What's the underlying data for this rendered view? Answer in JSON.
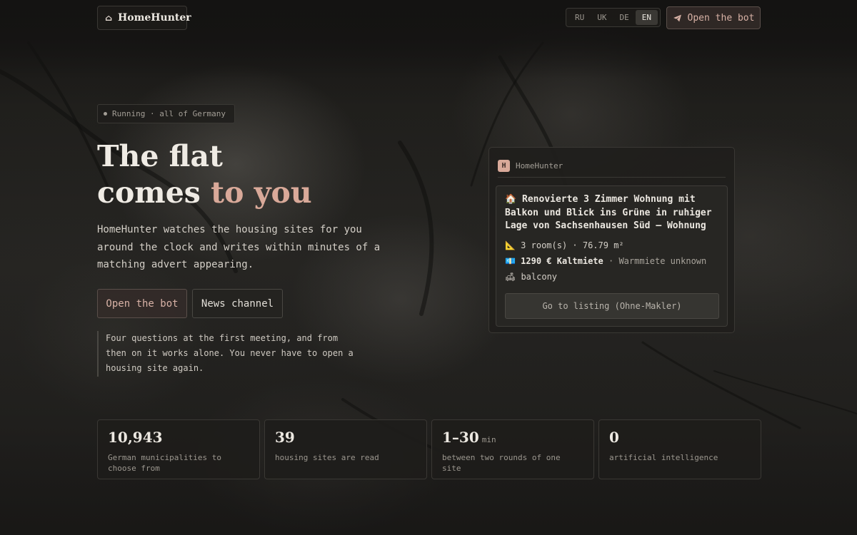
{
  "header": {
    "brand": "HomeHunter",
    "languages": [
      "RU",
      "UK",
      "DE",
      "EN"
    ],
    "active_language": "EN",
    "bot_button": "Open the bot"
  },
  "hero": {
    "status": "Running · all of Germany",
    "title_line1": "The flat",
    "title_line2_plain": "comes ",
    "title_line2_accent": "to you",
    "description": "HomeHunter watches the housing sites for you around the clock and writes within minutes of a matching advert appearing.",
    "cta_primary": "Open the bot",
    "cta_secondary": "News channel",
    "note": "Four questions at the first meeting, and from then on it works alone. You never have to open a housing site again."
  },
  "preview": {
    "avatar_letter": "H",
    "sender": "HomeHunter",
    "title": "🏠 Renovierte 3 Zimmer Wohnung mit Balkon und Blick ins Grüne in ruhiger Lage von Sachsenhausen Süd – Wohnung",
    "rooms_line": "📐 3 room(s) · 76.79 m²",
    "rent_strong": "💶 1290 € Kaltmiete",
    "rent_muted": " · Warmmiete unknown",
    "feature_line": "🛋 balcony",
    "listing_button": "Go to listing (Ohne-Makler)"
  },
  "stats": [
    {
      "value": "10,943",
      "unit": "",
      "label": "German municipalities to choose from"
    },
    {
      "value": "39",
      "unit": "",
      "label": "housing sites are read"
    },
    {
      "value": "1–30",
      "unit": "min",
      "label": "between two rounds of one site"
    },
    {
      "value": "0",
      "unit": "",
      "label": "artificial intelligence"
    }
  ],
  "colors": {
    "accent": "#d9a999",
    "background": "#1a1917",
    "border": "#3a3834"
  }
}
